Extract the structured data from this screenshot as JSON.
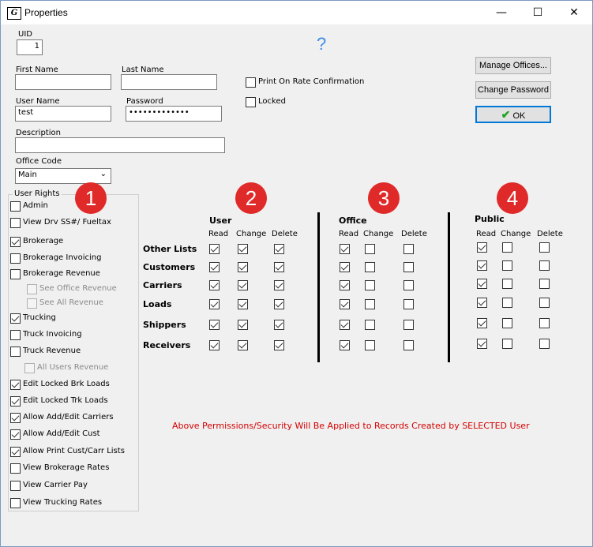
{
  "window": {
    "title": "Properties",
    "icon": "app-icon",
    "controls": {
      "minimize": "—",
      "maximize": "☐",
      "close": "✕"
    }
  },
  "fields": {
    "uid_label": "UID",
    "uid_value": "1",
    "first_name_label": "First Name",
    "first_name_value": "",
    "last_name_label": "Last Name",
    "last_name_value": "",
    "user_name_label": "User Name",
    "user_name_value": "test",
    "password_label": "Password",
    "password_value": "•••••••••••••",
    "description_label": "Description",
    "description_value": "",
    "office_code_label": "Office Code",
    "office_code_value": "Main"
  },
  "help_icon": "?",
  "options": {
    "print_on_rate": {
      "label": "Print On Rate Confirmation",
      "checked": false
    },
    "locked": {
      "label": "Locked",
      "checked": false
    }
  },
  "buttons": {
    "manage_offices": "Manage Offices...",
    "change_password": "Change Password",
    "ok": "OK"
  },
  "user_rights": {
    "title": "User Rights",
    "items": [
      {
        "label": "Admin",
        "checked": false,
        "disabled": false
      },
      {
        "label": "View Drv SS#/ Fueltax",
        "checked": false,
        "disabled": false
      },
      {
        "label": "Brokerage",
        "checked": true,
        "disabled": false
      },
      {
        "label": "Brokerage Invoicing",
        "checked": false,
        "disabled": false
      },
      {
        "label": "Brokerage Revenue",
        "checked": false,
        "disabled": false
      },
      {
        "label": "See Office Revenue",
        "checked": false,
        "disabled": true
      },
      {
        "label": "See All Revenue",
        "checked": false,
        "disabled": true
      },
      {
        "label": "Trucking",
        "checked": true,
        "disabled": false
      },
      {
        "label": "Truck Invoicing",
        "checked": false,
        "disabled": false
      },
      {
        "label": "Truck Revenue",
        "checked": false,
        "disabled": false
      },
      {
        "label": "All Users Revenue",
        "checked": false,
        "disabled": true
      },
      {
        "label": "Edit Locked Brk Loads",
        "checked": true,
        "disabled": false
      },
      {
        "label": "Edit Locked Trk Loads",
        "checked": true,
        "disabled": false
      },
      {
        "label": "Allow Add/Edit Carriers",
        "checked": true,
        "disabled": false
      },
      {
        "label": "Allow Add/Edit Cust",
        "checked": true,
        "disabled": false
      },
      {
        "label": "Allow Print Cust/Carr Lists",
        "checked": true,
        "disabled": false
      },
      {
        "label": "View Brokerage Rates",
        "checked": false,
        "disabled": false
      },
      {
        "label": "View Carrier Pay",
        "checked": false,
        "disabled": false
      },
      {
        "label": "View Trucking Rates",
        "checked": false,
        "disabled": false
      }
    ]
  },
  "badges": [
    "1",
    "2",
    "3",
    "4"
  ],
  "permissions": {
    "rows": [
      "Other Lists",
      "Customers",
      "Carriers",
      "Loads",
      "Shippers",
      "Receivers"
    ],
    "columns": [
      "Read",
      "Change",
      "Delete"
    ],
    "groups": [
      {
        "title": "User",
        "values": [
          [
            true,
            true,
            true
          ],
          [
            true,
            true,
            true
          ],
          [
            true,
            true,
            true
          ],
          [
            true,
            true,
            true
          ],
          [
            true,
            true,
            true
          ],
          [
            true,
            true,
            true
          ]
        ]
      },
      {
        "title": "Office",
        "values": [
          [
            true,
            false,
            false
          ],
          [
            true,
            false,
            false
          ],
          [
            true,
            false,
            false
          ],
          [
            true,
            false,
            false
          ],
          [
            true,
            false,
            false
          ],
          [
            true,
            false,
            false
          ]
        ]
      },
      {
        "title": "Public",
        "values": [
          [
            true,
            false,
            false
          ],
          [
            true,
            false,
            false
          ],
          [
            true,
            false,
            false
          ],
          [
            true,
            false,
            false
          ],
          [
            true,
            false,
            false
          ],
          [
            true,
            false,
            false
          ]
        ]
      }
    ]
  },
  "notice": "Above Permissions/Security Will Be Applied to Records Created by SELECTED User",
  "colors": {
    "badge": "#e02a2a",
    "notice": "#d40000",
    "help": "#3c8ce6",
    "ok_check": "#22a022"
  }
}
